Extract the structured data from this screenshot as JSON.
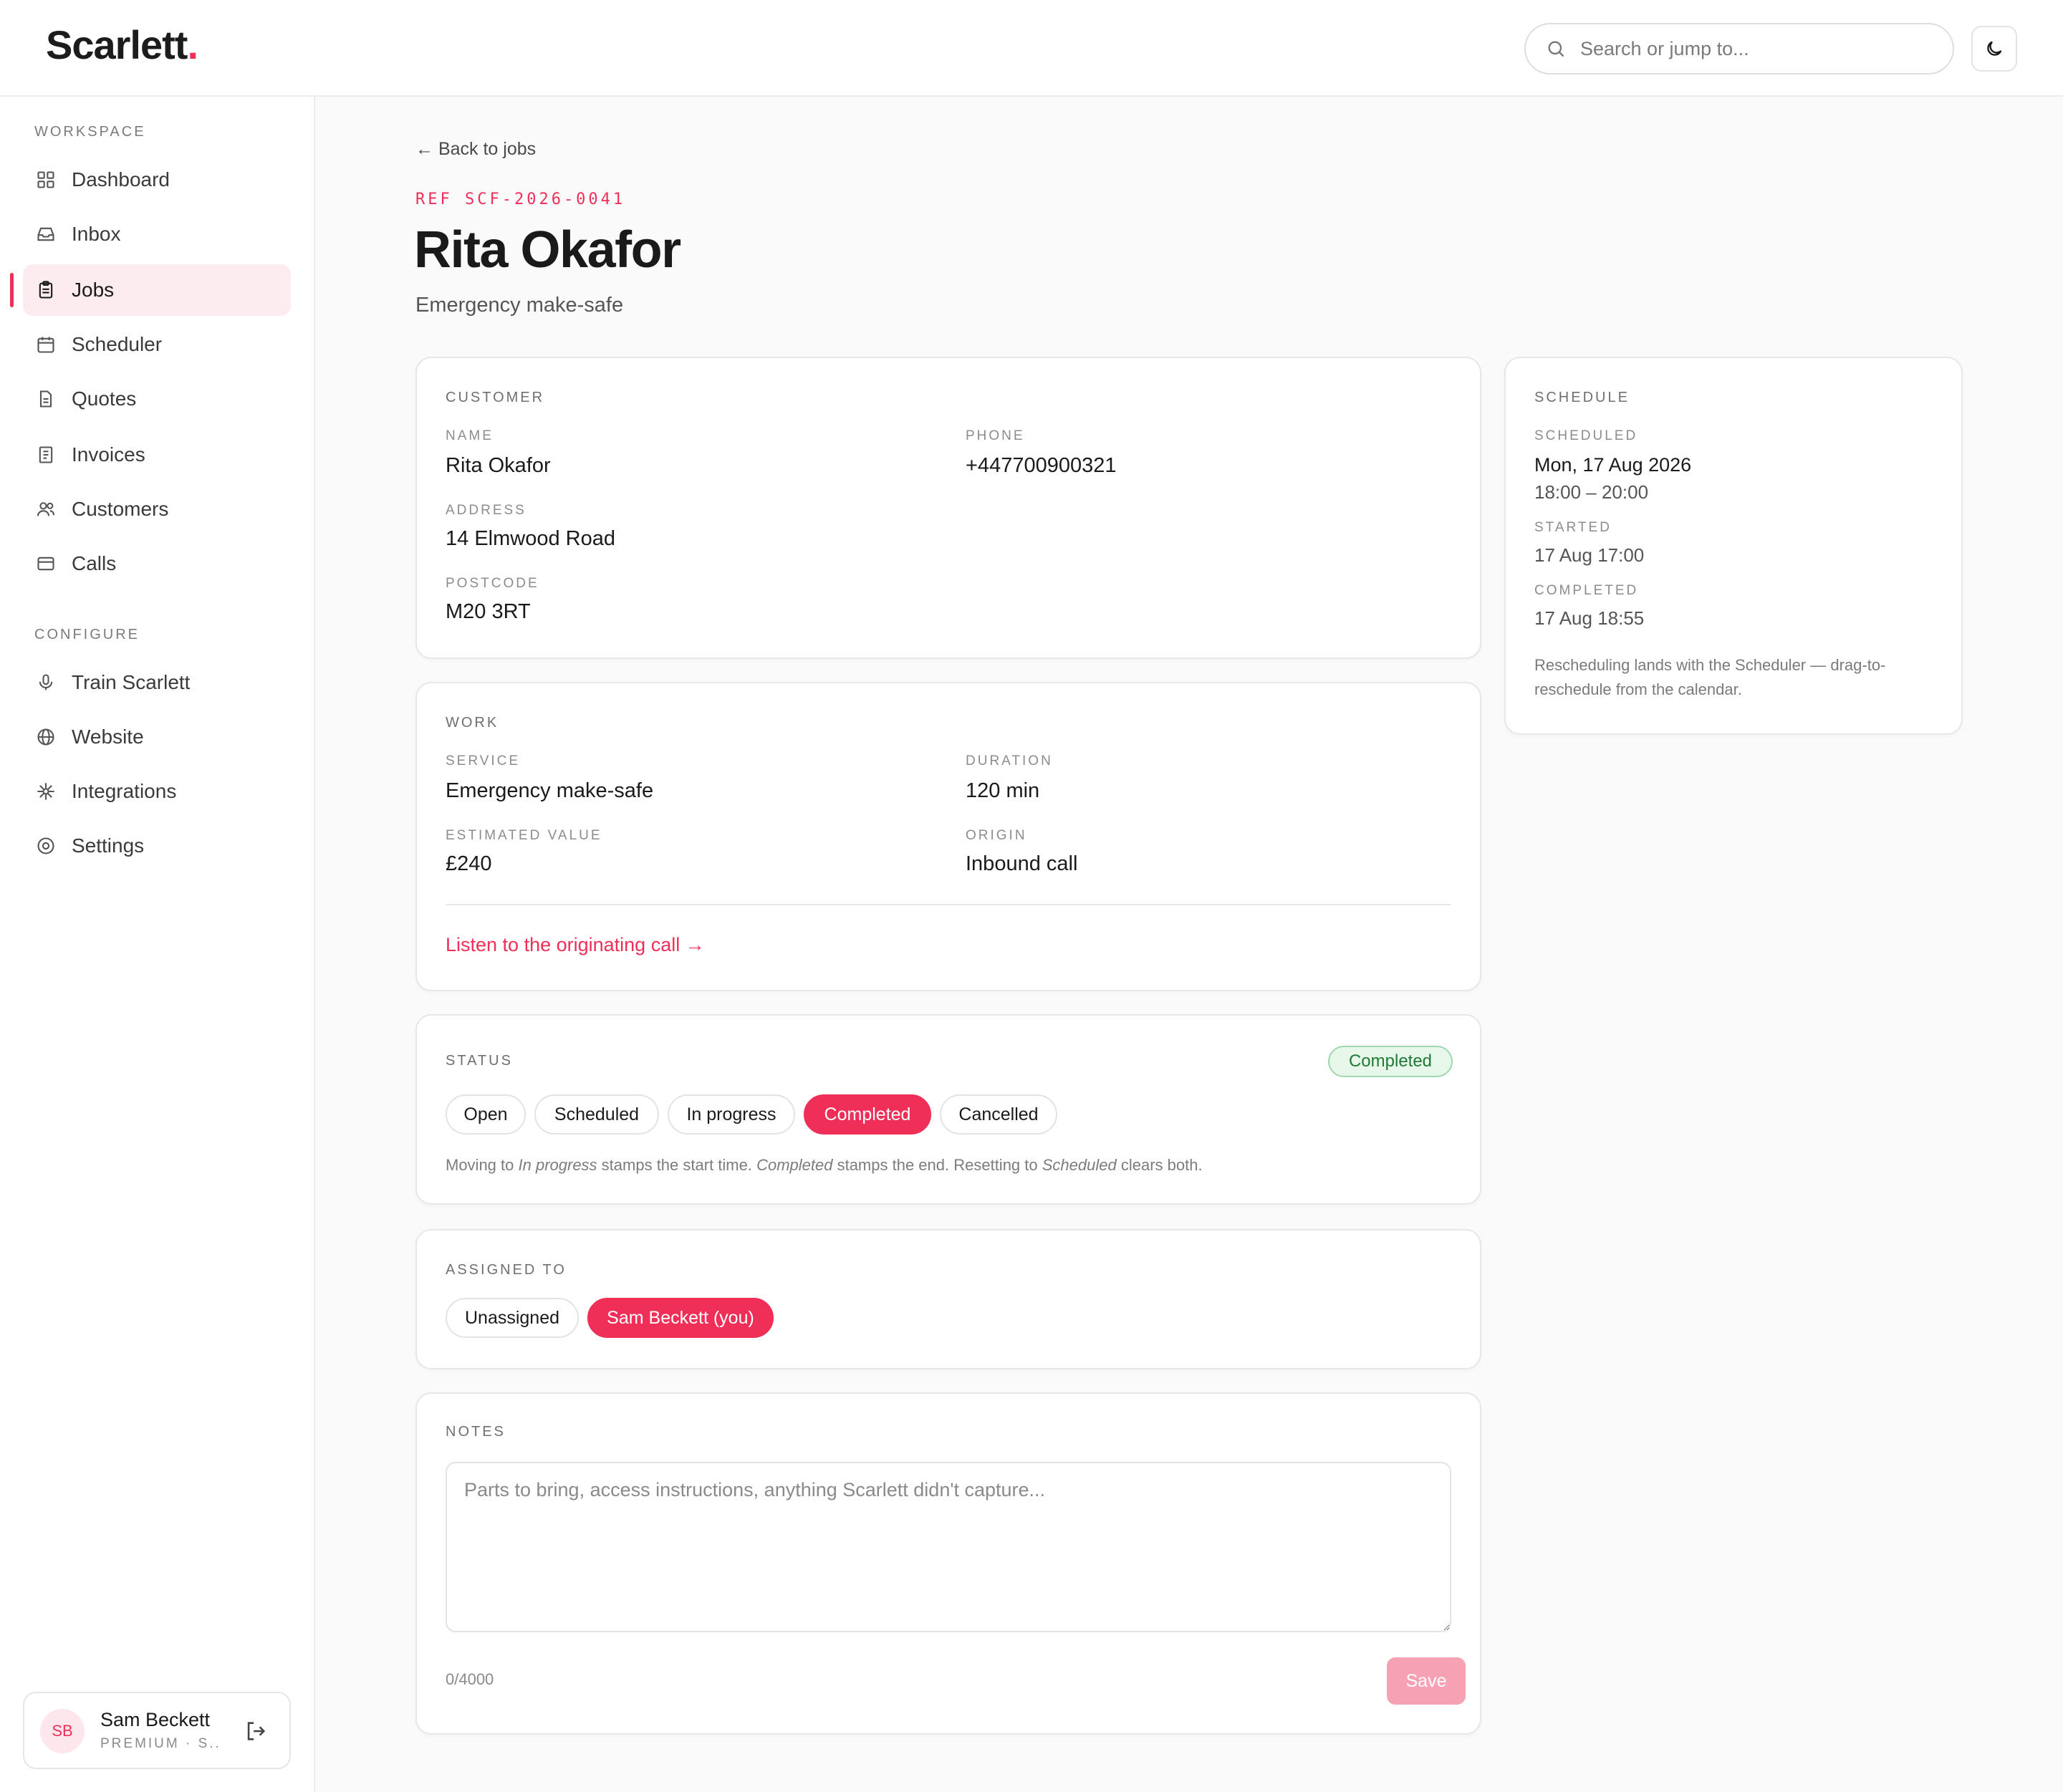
{
  "app": {
    "logo_text": "Scarlett",
    "logo_dot": ".",
    "accent": "#ef2f57"
  },
  "search": {
    "placeholder": "Search or jump to..."
  },
  "sidebar": {
    "workspace_label": "WORKSPACE",
    "configure_label": "CONFIGURE",
    "workspace_items": [
      {
        "label": "Dashboard",
        "icon": "grid-icon"
      },
      {
        "label": "Inbox",
        "icon": "inbox-icon"
      },
      {
        "label": "Jobs",
        "icon": "clipboard-icon",
        "active": true
      },
      {
        "label": "Scheduler",
        "icon": "calendar-icon"
      },
      {
        "label": "Quotes",
        "icon": "document-icon"
      },
      {
        "label": "Invoices",
        "icon": "receipt-icon"
      },
      {
        "label": "Customers",
        "icon": "users-icon"
      },
      {
        "label": "Calls",
        "icon": "phone-card-icon"
      }
    ],
    "configure_items": [
      {
        "label": "Train Scarlett",
        "icon": "microphone-icon"
      },
      {
        "label": "Website",
        "icon": "globe-icon"
      },
      {
        "label": "Integrations",
        "icon": "sparkle-icon"
      },
      {
        "label": "Settings",
        "icon": "settings-icon"
      }
    ],
    "user": {
      "initials": "SB",
      "name": "Sam Beckett",
      "plan": "PREMIUM · S..."
    }
  },
  "page": {
    "back_link": "← Back to jobs",
    "ref": "REF SCF-2026-0041",
    "title": "Rita Okafor",
    "subtitle": "Emergency make-safe"
  },
  "customer": {
    "heading": "CUSTOMER",
    "name_label": "NAME",
    "name": "Rita Okafor",
    "phone_label": "PHONE",
    "phone": "+447700900321",
    "address_label": "ADDRESS",
    "address": "14 Elmwood Road",
    "postcode_label": "POSTCODE",
    "postcode": "M20 3RT"
  },
  "work": {
    "heading": "WORK",
    "service_label": "SERVICE",
    "service": "Emergency make-safe",
    "duration_label": "DURATION",
    "duration": "120 min",
    "value_label": "ESTIMATED VALUE",
    "value": "£240",
    "origin_label": "ORIGIN",
    "origin": "Inbound call",
    "call_link": "Listen to the originating call →"
  },
  "status": {
    "heading": "STATUS",
    "badge": "Completed",
    "options": [
      "Open",
      "Scheduled",
      "In progress",
      "Completed",
      "Cancelled"
    ],
    "selected": "Completed",
    "hint_1": "Moving to ",
    "hint_in_progress": "In progress",
    "hint_2": " stamps the start time. ",
    "hint_completed": "Completed",
    "hint_3": " stamps the end. Resetting to ",
    "hint_scheduled": "Scheduled",
    "hint_4": " clears both."
  },
  "assigned": {
    "heading": "ASSIGNED TO",
    "options": [
      "Unassigned",
      "Sam Beckett (you)"
    ],
    "selected": "Sam Beckett (you)"
  },
  "notes": {
    "heading": "NOTES",
    "placeholder": "Parts to bring, access instructions, anything Scarlett didn't capture...",
    "value": "",
    "counter": "0/4000",
    "save_label": "Save"
  },
  "schedule": {
    "heading": "SCHEDULE",
    "scheduled_label": "SCHEDULED",
    "scheduled_date": "Mon, 17 Aug 2026",
    "scheduled_time": "18:00 – 20:00",
    "started_label": "STARTED",
    "started": "17 Aug 17:00",
    "completed_label": "COMPLETED",
    "completed": "17 Aug 18:55",
    "note": "Rescheduling lands with the Scheduler — drag-to-reschedule from the calendar."
  }
}
